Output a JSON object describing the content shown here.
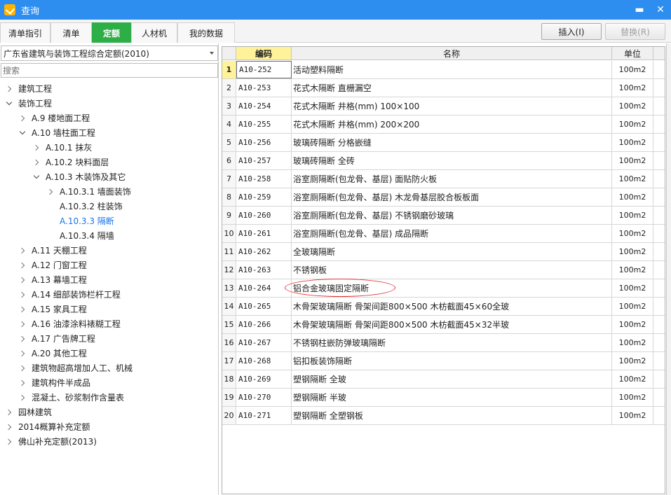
{
  "window": {
    "title": "查询",
    "minimize": "▬",
    "close": "✕"
  },
  "tabs": [
    {
      "label": "清单指引"
    },
    {
      "label": "清单"
    },
    {
      "label": "定额"
    },
    {
      "label": "人材机"
    },
    {
      "label": "我的数据"
    }
  ],
  "buttons": {
    "insert": "插入(I)",
    "replace": "替换(R)"
  },
  "left": {
    "quota_library": "广东省建筑与装饰工程综合定额(2010)",
    "search_placeholder": "搜索",
    "tree": [
      {
        "label": "建筑工程",
        "level": 0,
        "state": "collapsed"
      },
      {
        "label": "装饰工程",
        "level": 0,
        "state": "expanded"
      },
      {
        "label": "A.9 楼地面工程",
        "level": 1,
        "state": "collapsed"
      },
      {
        "label": "A.10 墙柱面工程",
        "level": 1,
        "state": "expanded"
      },
      {
        "label": "A.10.1 抹灰",
        "level": 2,
        "state": "collapsed"
      },
      {
        "label": "A.10.2 块料面层",
        "level": 2,
        "state": "collapsed"
      },
      {
        "label": "A.10.3 木装饰及其它",
        "level": 2,
        "state": "expanded"
      },
      {
        "label": "A.10.3.1 墙面装饰",
        "level": 3,
        "state": "collapsed"
      },
      {
        "label": "A.10.3.2 柱装饰",
        "level": 3,
        "state": "leaf"
      },
      {
        "label": "A.10.3.3 隔断",
        "level": 3,
        "state": "leaf",
        "selected": true
      },
      {
        "label": "A.10.3.4 隔墙",
        "level": 3,
        "state": "leaf"
      },
      {
        "label": "A.11 天棚工程",
        "level": 1,
        "state": "collapsed"
      },
      {
        "label": "A.12 门窗工程",
        "level": 1,
        "state": "collapsed"
      },
      {
        "label": "A.13 幕墙工程",
        "level": 1,
        "state": "collapsed"
      },
      {
        "label": "A.14 细部装饰栏杆工程",
        "level": 1,
        "state": "collapsed"
      },
      {
        "label": "A.15 家具工程",
        "level": 1,
        "state": "collapsed"
      },
      {
        "label": "A.16 油漆涂料裱糊工程",
        "level": 1,
        "state": "collapsed"
      },
      {
        "label": "A.17 广告牌工程",
        "level": 1,
        "state": "collapsed"
      },
      {
        "label": "A.20 其他工程",
        "level": 1,
        "state": "collapsed"
      },
      {
        "label": "建筑物超高增加人工、机械",
        "level": 1,
        "state": "collapsed"
      },
      {
        "label": "建筑构件半成品",
        "level": 1,
        "state": "collapsed"
      },
      {
        "label": "混凝土、砂浆制作含量表",
        "level": 1,
        "state": "collapsed"
      },
      {
        "label": "园林建筑",
        "level": 0,
        "state": "collapsed"
      },
      {
        "label": "2014概算补充定额",
        "level": 0,
        "state": "collapsed"
      },
      {
        "label": "佛山补充定额(2013)",
        "level": 0,
        "state": "collapsed"
      }
    ]
  },
  "grid": {
    "columns": {
      "code": "编码",
      "name": "名称",
      "unit": "单位"
    },
    "rows": [
      {
        "no": "1",
        "code": "A10-252",
        "name": "活动塑料隔断",
        "unit": "100m2"
      },
      {
        "no": "2",
        "code": "A10-253",
        "name": "花式木隔断 直栅漏空",
        "unit": "100m2"
      },
      {
        "no": "3",
        "code": "A10-254",
        "name": "花式木隔断 井格(mm) 100×100",
        "unit": "100m2"
      },
      {
        "no": "4",
        "code": "A10-255",
        "name": "花式木隔断 井格(mm) 200×200",
        "unit": "100m2"
      },
      {
        "no": "5",
        "code": "A10-256",
        "name": "玻璃砖隔断 分格嵌缝",
        "unit": "100m2"
      },
      {
        "no": "6",
        "code": "A10-257",
        "name": "玻璃砖隔断 全砖",
        "unit": "100m2"
      },
      {
        "no": "7",
        "code": "A10-258",
        "name": "浴室厕隔断(包龙骨、基层) 面贴防火板",
        "unit": "100m2"
      },
      {
        "no": "8",
        "code": "A10-259",
        "name": "浴室厕隔断(包龙骨、基层) 木龙骨基层胶合板板面",
        "unit": "100m2"
      },
      {
        "no": "9",
        "code": "A10-260",
        "name": "浴室厕隔断(包龙骨、基层) 不锈钢磨砂玻璃",
        "unit": "100m2"
      },
      {
        "no": "10",
        "code": "A10-261",
        "name": "浴室厕隔断(包龙骨、基层) 成品隔断",
        "unit": "100m2"
      },
      {
        "no": "11",
        "code": "A10-262",
        "name": "全玻璃隔断",
        "unit": "100m2"
      },
      {
        "no": "12",
        "code": "A10-263",
        "name": "不锈钢板",
        "unit": "100m2"
      },
      {
        "no": "13",
        "code": "A10-264",
        "name": "铝合金玻璃固定隔断",
        "unit": "100m2"
      },
      {
        "no": "14",
        "code": "A10-265",
        "name": "木骨架玻璃隔断 骨架间距800×500 木枋截面45×60全玻",
        "unit": "100m2"
      },
      {
        "no": "15",
        "code": "A10-266",
        "name": "木骨架玻璃隔断 骨架间距800×500 木枋截面45×32半玻",
        "unit": "100m2"
      },
      {
        "no": "16",
        "code": "A10-267",
        "name": "不锈钢柱嵌防弹玻璃隔断",
        "unit": "100m2"
      },
      {
        "no": "17",
        "code": "A10-268",
        "name": "铝扣板装饰隔断",
        "unit": "100m2"
      },
      {
        "no": "18",
        "code": "A10-269",
        "name": "塑钢隔断 全玻",
        "unit": "100m2"
      },
      {
        "no": "19",
        "code": "A10-270",
        "name": "塑钢隔断 半玻",
        "unit": "100m2"
      },
      {
        "no": "20",
        "code": "A10-271",
        "name": "塑钢隔断 全塑钢板",
        "unit": "100m2"
      }
    ]
  }
}
